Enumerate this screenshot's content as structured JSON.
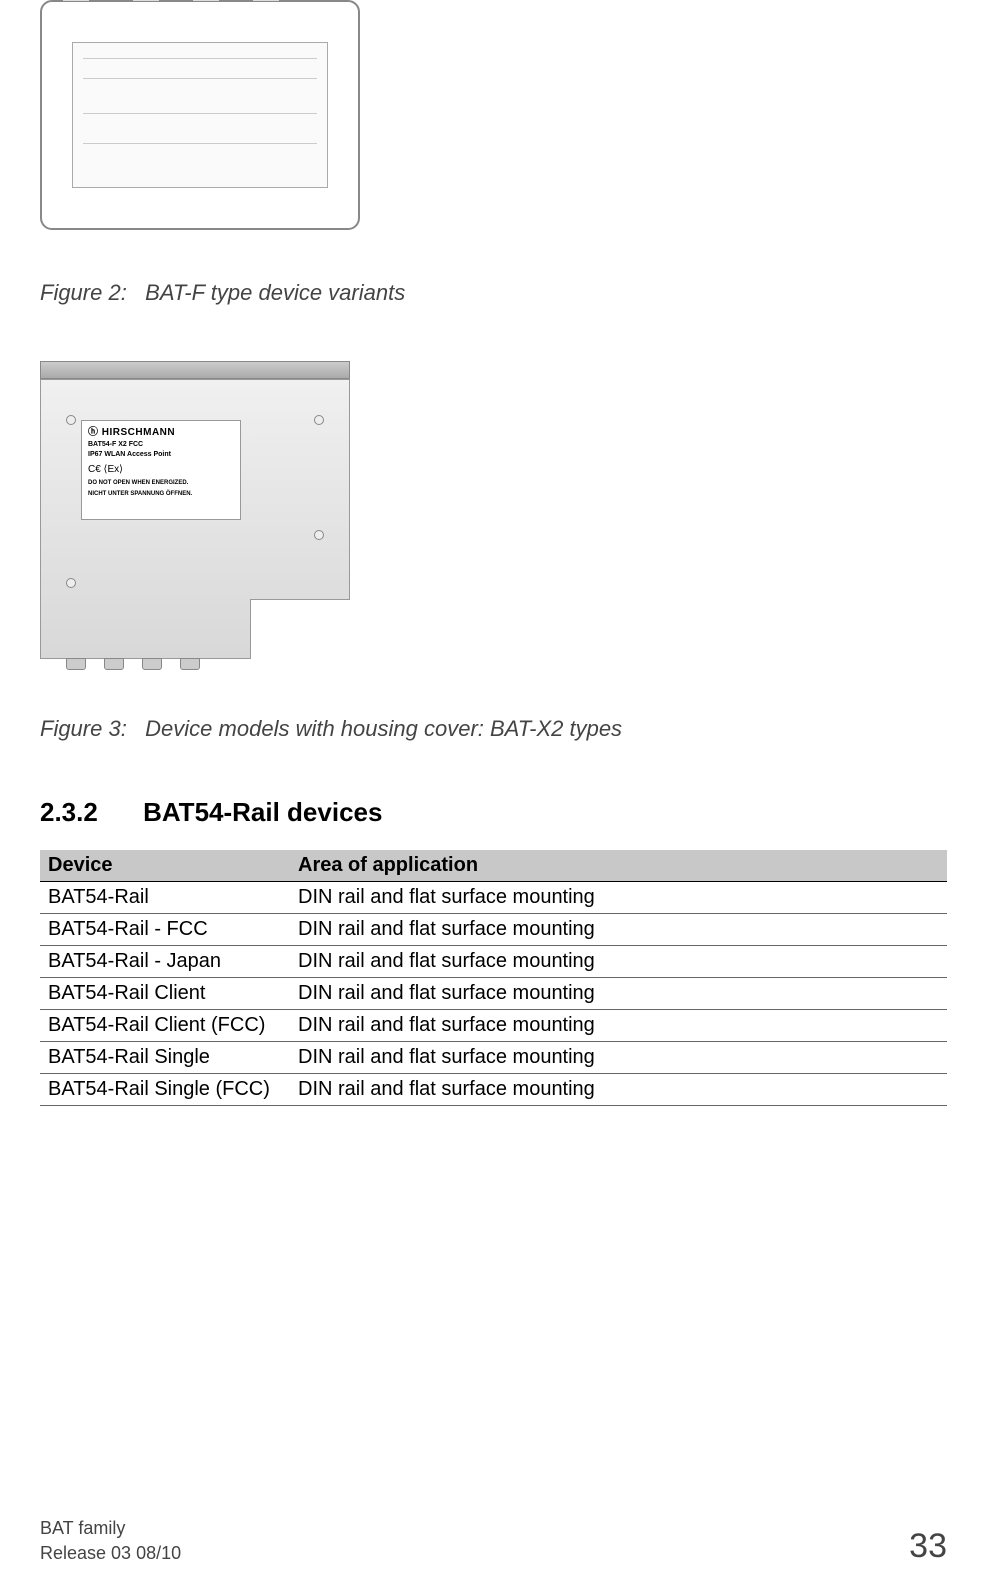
{
  "figure2": {
    "caption_prefix": "Figure 2:",
    "caption_text": "BAT-F type device variants"
  },
  "figure3": {
    "caption_prefix": "Figure 3:",
    "caption_text": "Device models with housing cover: BAT-X2 types",
    "label": {
      "brand": "HIRSCHMANN",
      "model_line1": "BAT54-F X2 FCC",
      "model_line2": "IP67 WLAN Access Point",
      "warning_line1": "DO NOT OPEN WHEN ENERGIZED.",
      "warning_line2": "NICHT UNTER SPANNUNG ÖFFNEN."
    }
  },
  "section": {
    "number": "2.3.2",
    "title": "BAT54-Rail devices"
  },
  "table": {
    "headers": {
      "col1": "Device",
      "col2": "Area of application"
    },
    "rows": [
      {
        "device": "BAT54-Rail",
        "area": "DIN rail and flat surface mounting"
      },
      {
        "device": "BAT54-Rail - FCC",
        "area": "DIN rail and flat surface mounting"
      },
      {
        "device": "BAT54-Rail - Japan",
        "area": "DIN rail and flat surface mounting"
      },
      {
        "device": "BAT54-Rail Client",
        "area": "DIN rail and flat surface mounting"
      },
      {
        "device": "BAT54-Rail Client (FCC)",
        "area": "DIN rail and flat surface mounting"
      },
      {
        "device": "BAT54-Rail Single",
        "area": "DIN rail and flat surface mounting"
      },
      {
        "device": "BAT54-Rail Single (FCC)",
        "area": "DIN rail and flat surface mounting"
      }
    ]
  },
  "footer": {
    "line1": "BAT family",
    "line2": "Release  03  08/10",
    "page": "33"
  }
}
